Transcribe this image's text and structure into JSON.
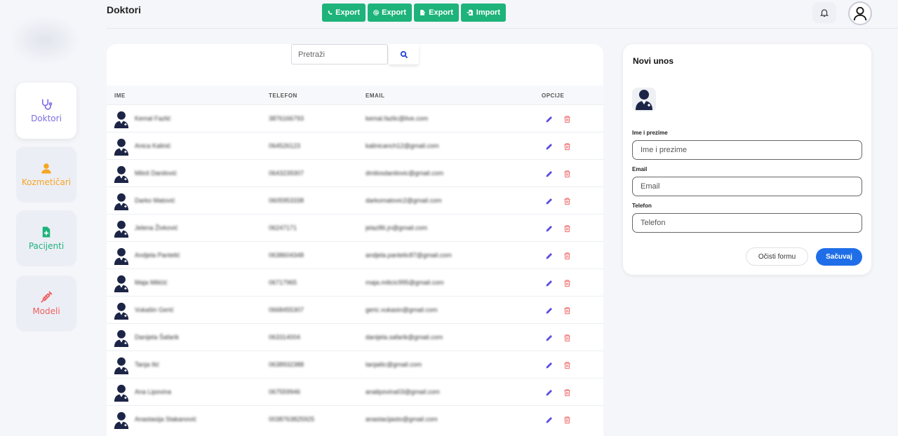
{
  "header": {
    "title": "Doktori",
    "actions": [
      {
        "label": "Export",
        "icon": "phone-icon"
      },
      {
        "label": "Export",
        "icon": "at-icon"
      },
      {
        "label": "Export",
        "icon": "file-export-icon"
      },
      {
        "label": "Import",
        "icon": "file-import-icon"
      }
    ]
  },
  "sidebar": {
    "items": [
      {
        "label": "Doktori",
        "icon": "stethoscope-icon",
        "color": "#7b6ee6",
        "active": true
      },
      {
        "label": "Kozmetičari",
        "icon": "user-icon",
        "color": "#f5a623",
        "active": false
      },
      {
        "label": "Pacijenti",
        "icon": "file-medical-icon",
        "color": "#1db37a",
        "active": false
      },
      {
        "label": "Modeli",
        "icon": "syringe-icon",
        "color": "#ee5f5f",
        "active": false
      }
    ]
  },
  "search": {
    "placeholder": "Pretraži"
  },
  "table": {
    "columns": [
      "IME",
      "TELEFON",
      "EMAIL",
      "OPCIJE"
    ],
    "rows": [
      {
        "name": "Kemal Fazlić",
        "phone": "3876166793",
        "email": "kemal.fazlic@live.com"
      },
      {
        "name": "Anica Kalinić",
        "phone": "064526123",
        "email": "kalinicanch12@gmail.com"
      },
      {
        "name": "Miloš Danilović",
        "phone": "0643239307",
        "email": "dmilosdanilovic@gmail.com"
      },
      {
        "name": "Darko Matović",
        "phone": "0605953338",
        "email": "darkomatovic2@gmail.com"
      },
      {
        "name": "Jelena Živković",
        "phone": "06247171",
        "email": "jelaz86.jn@gmail.com"
      },
      {
        "name": "Andjela Pantelić",
        "phone": "0638604348",
        "email": "andjela.pantelic87@gmail.com"
      },
      {
        "name": "Maja Milićić",
        "phone": "06717965",
        "email": "maja.milicic995@gmail.com"
      },
      {
        "name": "Vukašin Gerić",
        "phone": "0668455307",
        "email": "geric.vukasin@gmail.com"
      },
      {
        "name": "Danijela Šafarik",
        "phone": "063314004",
        "email": "danijela.safarik@gmail.com"
      },
      {
        "name": "Tanja Ilić",
        "phone": "0638932388",
        "email": "tanjailic@gmail.com"
      },
      {
        "name": "Ana Lipovina",
        "phone": "067559946",
        "email": "analipovina03@gmail.com"
      },
      {
        "name": "Anastasija Stakanović",
        "phone": "0038763825925",
        "email": "anastacijasto@gmail.com"
      }
    ]
  },
  "form": {
    "title": "Novi unos",
    "fields": [
      {
        "label": "Ime i prezime",
        "placeholder": "Ime i prezime"
      },
      {
        "label": "Email",
        "placeholder": "Email"
      },
      {
        "label": "Telefon",
        "placeholder": "Telefon"
      }
    ],
    "clear_label": "Očisti formu",
    "save_label": "Sačuvaj"
  },
  "colors": {
    "accent_green": "#1db37a",
    "primary_blue": "#1f6ee8",
    "edit_icon": "#5a4fe0",
    "delete_icon": "#ee6b6b",
    "avatar_navy": "#1d2547"
  }
}
